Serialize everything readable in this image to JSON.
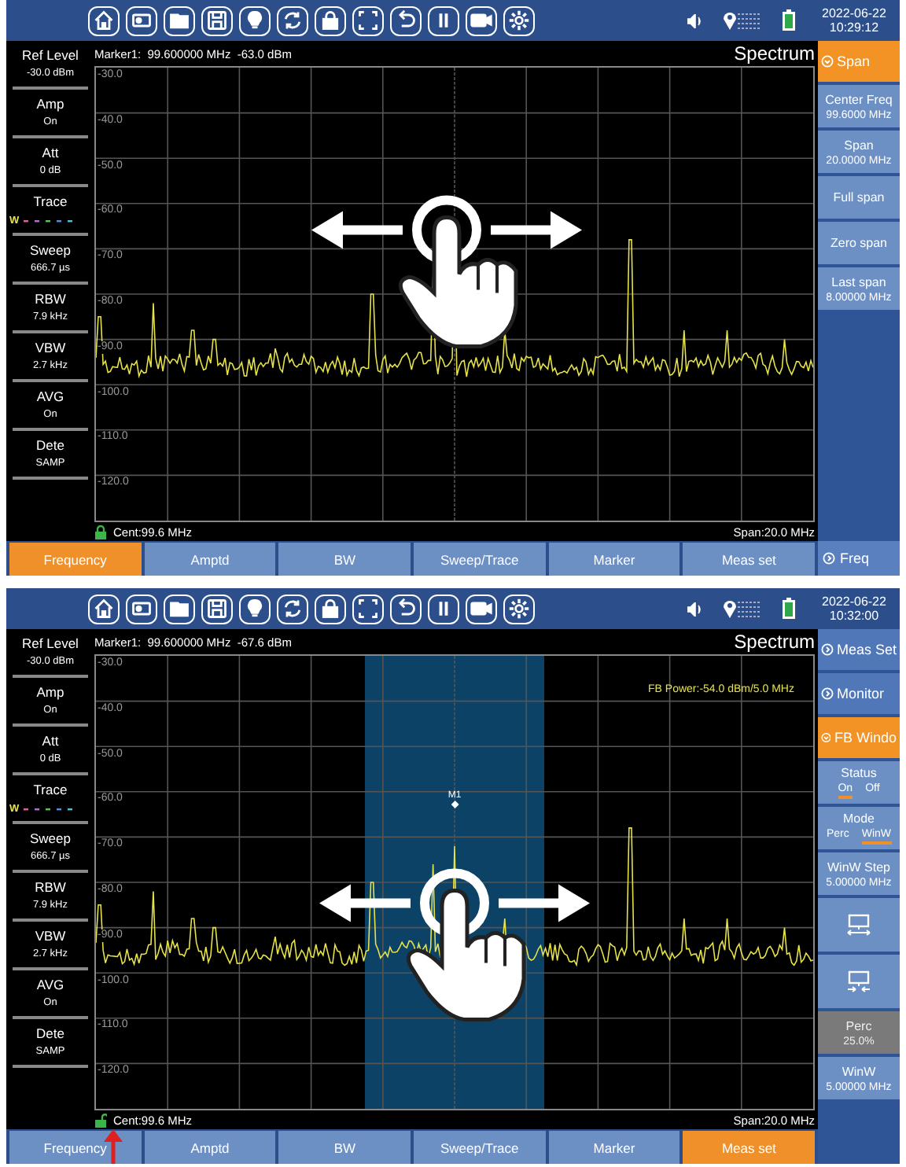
{
  "screens": [
    {
      "date": "2022-06-22",
      "time": "10:29:12",
      "marker_readout": "Marker1:  99.600000 MHz  -63.0 dBm",
      "mode_title": "Spectrum",
      "side_params": [
        {
          "kind": "value",
          "label": "Ref Level",
          "value": "-30.0 dBm"
        },
        {
          "kind": "value",
          "label": "Amp",
          "value": "On"
        },
        {
          "kind": "value",
          "label": "Att",
          "value": "0 dB"
        },
        {
          "kind": "trace",
          "label": "Trace",
          "value": "W"
        },
        {
          "kind": "value",
          "label": "Sweep",
          "value": "666.7 µs"
        },
        {
          "kind": "value",
          "label": "RBW",
          "value": "7.9 kHz"
        },
        {
          "kind": "value",
          "label": "VBW",
          "value": "2.7 kHz"
        },
        {
          "kind": "value",
          "label": "AVG",
          "value": "On"
        },
        {
          "kind": "value",
          "label": "Dete",
          "value": "SAMP"
        }
      ],
      "y_ticks": [
        "-30.0",
        "-40.0",
        "-50.0",
        "-60.0",
        "-70.0",
        "-80.0",
        "-90.0",
        "-100.0",
        "-110.0",
        "-120.0"
      ],
      "center": "Cent:99.6 MHz",
      "span": "Span:20.0 MHz",
      "locked": true,
      "tabs": [
        {
          "label": "Frequency",
          "selected": true
        },
        {
          "label": "Amptd",
          "selected": false
        },
        {
          "label": "BW",
          "selected": false
        },
        {
          "label": "Sweep/Trace",
          "selected": false
        },
        {
          "label": "Marker",
          "selected": false
        },
        {
          "label": "Meas set",
          "selected": false
        }
      ],
      "menu": [
        {
          "kind": "header",
          "label": "Span",
          "selected": true
        },
        {
          "kind": "param",
          "label": "Center Freq",
          "value": "99.6000 MHz",
          "disabled": false
        },
        {
          "kind": "param",
          "label": "Span",
          "value": "20.0000 MHz",
          "disabled": false
        },
        {
          "kind": "param",
          "label": "Full span",
          "disabled": false
        },
        {
          "kind": "param",
          "label": "Zero span",
          "disabled": false
        },
        {
          "kind": "param",
          "label": "Last span",
          "value": "8.00000 MHz",
          "disabled": false
        }
      ],
      "menu_footer": "Freq"
    },
    {
      "date": "2022-06-22",
      "time": "10:32:00",
      "marker_readout": "Marker1:  99.600000 MHz  -67.6 dBm",
      "mode_title": "Spectrum",
      "side_params": [
        {
          "kind": "value",
          "label": "Ref Level",
          "value": "-30.0 dBm"
        },
        {
          "kind": "value",
          "label": "Amp",
          "value": "On"
        },
        {
          "kind": "value",
          "label": "Att",
          "value": "0 dB"
        },
        {
          "kind": "trace",
          "label": "Trace",
          "value": "W"
        },
        {
          "kind": "value",
          "label": "Sweep",
          "value": "666.7 µs"
        },
        {
          "kind": "value",
          "label": "RBW",
          "value": "7.9 kHz"
        },
        {
          "kind": "value",
          "label": "VBW",
          "value": "2.7 kHz"
        },
        {
          "kind": "value",
          "label": "AVG",
          "value": "On"
        },
        {
          "kind": "value",
          "label": "Dete",
          "value": "SAMP"
        }
      ],
      "y_ticks": [
        "-30.0",
        "-40.0",
        "-50.0",
        "-60.0",
        "-70.0",
        "-80.0",
        "-90.0",
        "-100.0",
        "-110.0",
        "-120.0"
      ],
      "fb_power": "FB Power:-54.0 dBm/5.0 MHz",
      "marker_label": "M1",
      "center": "Cent:99.6 MHz",
      "span": "Span:20.0 MHz",
      "locked": false,
      "tabs": [
        {
          "label": "Frequency",
          "selected": false
        },
        {
          "label": "Amptd",
          "selected": false
        },
        {
          "label": "BW",
          "selected": false
        },
        {
          "label": "Sweep/Trace",
          "selected": false
        },
        {
          "label": "Marker",
          "selected": false
        },
        {
          "label": "Meas set",
          "selected": true
        }
      ],
      "menu": [
        {
          "kind": "header",
          "label": "Meas Set",
          "selected": false
        },
        {
          "kind": "header",
          "label": "Monitor",
          "selected": false
        },
        {
          "kind": "header",
          "label": "FB Windo",
          "selected": true
        },
        {
          "kind": "toggle",
          "label": "Status",
          "options": [
            {
              "label": "On",
              "selected": true
            },
            {
              "label": "Off",
              "selected": false
            }
          ]
        },
        {
          "kind": "toggle",
          "label": "Mode",
          "options": [
            {
              "label": "Perc",
              "selected": false
            },
            {
              "label": "WinW",
              "selected": true
            }
          ]
        },
        {
          "kind": "param",
          "label": "WinW Step",
          "value": "5.00000 MHz",
          "disabled": false
        },
        {
          "kind": "expand"
        },
        {
          "kind": "shrink"
        },
        {
          "kind": "param",
          "label": "Perc",
          "value": "25.0%",
          "disabled": true
        },
        {
          "kind": "param",
          "label": "WinW",
          "value": "5.00000 MHz",
          "disabled": false
        }
      ]
    }
  ]
}
